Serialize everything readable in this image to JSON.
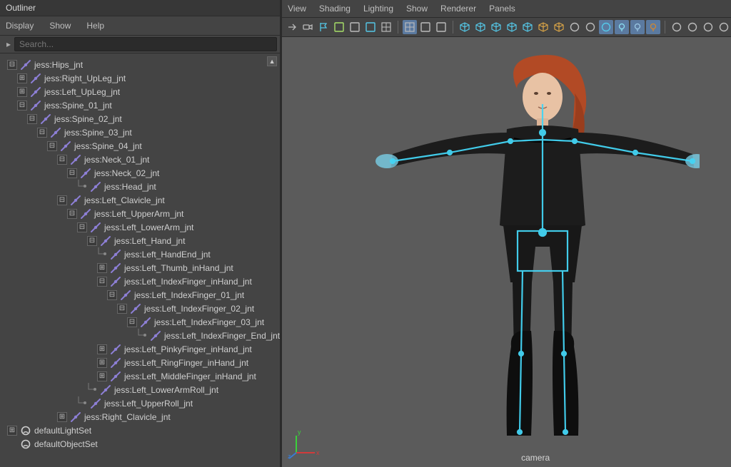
{
  "outliner": {
    "title": "Outliner",
    "menu": [
      "Display",
      "Show",
      "Help"
    ],
    "search_placeholder": "Search...",
    "tree": [
      {
        "d": 0,
        "exp": "minus",
        "ic": "joint",
        "label": "jess:Hips_jnt"
      },
      {
        "d": 1,
        "exp": "plus",
        "ic": "joint",
        "label": "jess:Right_UpLeg_jnt"
      },
      {
        "d": 1,
        "exp": "plus",
        "ic": "joint",
        "label": "jess:Left_UpLeg_jnt"
      },
      {
        "d": 1,
        "exp": "minus",
        "ic": "joint",
        "label": "jess:Spine_01_jnt"
      },
      {
        "d": 2,
        "exp": "minus",
        "ic": "joint",
        "label": "jess:Spine_02_jnt"
      },
      {
        "d": 3,
        "exp": "minus",
        "ic": "joint",
        "label": "jess:Spine_03_jnt"
      },
      {
        "d": 4,
        "exp": "minus",
        "ic": "joint",
        "label": "jess:Spine_04_jnt"
      },
      {
        "d": 5,
        "exp": "minus",
        "ic": "joint",
        "label": "jess:Neck_01_jnt"
      },
      {
        "d": 6,
        "exp": "minus",
        "ic": "joint",
        "label": "jess:Neck_02_jnt"
      },
      {
        "d": 7,
        "exp": "leaf",
        "ic": "joint",
        "label": "jess:Head_jnt"
      },
      {
        "d": 5,
        "exp": "minus",
        "ic": "joint",
        "label": "jess:Left_Clavicle_jnt"
      },
      {
        "d": 6,
        "exp": "minus",
        "ic": "joint",
        "label": "jess:Left_UpperArm_jnt"
      },
      {
        "d": 7,
        "exp": "minus",
        "ic": "joint",
        "label": "jess:Left_LowerArm_jnt"
      },
      {
        "d": 8,
        "exp": "minus",
        "ic": "joint",
        "label": "jess:Left_Hand_jnt"
      },
      {
        "d": 9,
        "exp": "leaf",
        "ic": "joint",
        "label": "jess:Left_HandEnd_jnt"
      },
      {
        "d": 9,
        "exp": "plus",
        "ic": "joint",
        "label": "jess:Left_Thumb_inHand_jnt"
      },
      {
        "d": 9,
        "exp": "minus",
        "ic": "joint",
        "label": "jess:Left_IndexFinger_inHand_jnt"
      },
      {
        "d": 10,
        "exp": "minus",
        "ic": "joint",
        "label": "jess:Left_IndexFinger_01_jnt"
      },
      {
        "d": 11,
        "exp": "minus",
        "ic": "joint",
        "label": "jess:Left_IndexFinger_02_jnt"
      },
      {
        "d": 12,
        "exp": "minus",
        "ic": "joint",
        "label": "jess:Left_IndexFinger_03_jnt"
      },
      {
        "d": 13,
        "exp": "leaf",
        "ic": "joint",
        "label": "jess:Left_IndexFinger_End_jnt"
      },
      {
        "d": 9,
        "exp": "plus",
        "ic": "joint",
        "label": "jess:Left_PinkyFinger_inHand_jnt"
      },
      {
        "d": 9,
        "exp": "plus",
        "ic": "joint",
        "label": "jess:Left_RingFinger_inHand_jnt"
      },
      {
        "d": 9,
        "exp": "plus",
        "ic": "joint",
        "label": "jess:Left_MiddleFinger_inHand_jnt"
      },
      {
        "d": 8,
        "exp": "leaf",
        "ic": "joint",
        "label": "jess:Left_LowerArmRoll_jnt"
      },
      {
        "d": 7,
        "exp": "leaf",
        "ic": "joint",
        "label": "jess:Left_UpperRoll_jnt"
      },
      {
        "d": 5,
        "exp": "plus",
        "ic": "joint",
        "label": "jess:Right_Clavicle_jnt"
      },
      {
        "d": 0,
        "exp": "plus",
        "ic": "set",
        "label": "defaultLightSet"
      },
      {
        "d": 0,
        "exp": "none",
        "ic": "set",
        "label": "defaultObjectSet"
      }
    ]
  },
  "viewport": {
    "menu": [
      "View",
      "Shading",
      "Lighting",
      "Show",
      "Renderer",
      "Panels"
    ],
    "camera_label": "camera",
    "axis": {
      "x": "x",
      "y": "y",
      "z": "z"
    },
    "toolbar": [
      {
        "name": "select-camera-icon",
        "c": "#bbb"
      },
      {
        "name": "camera-icon",
        "c": "#bbb"
      },
      {
        "name": "bookmark-icon",
        "c": "#55c8e8"
      },
      {
        "name": "image-plane-icon",
        "c": "#a8e069"
      },
      {
        "name": "film-gate-icon",
        "c": "#bbb"
      },
      {
        "name": "gate-mask-icon",
        "c": "#55c8e8"
      },
      {
        "name": "field-chart-icon",
        "c": "#bbb"
      },
      {
        "name": "sep"
      },
      {
        "name": "grid-icon",
        "c": "#bbb",
        "active": true
      },
      {
        "name": "resolution-gate-icon",
        "c": "#bbb"
      },
      {
        "name": "safe-action-icon",
        "c": "#bbb"
      },
      {
        "name": "sep"
      },
      {
        "name": "wireframe-icon",
        "c": "#55c8e8"
      },
      {
        "name": "smooth-shade-icon",
        "c": "#55c8e8"
      },
      {
        "name": "textured-icon",
        "c": "#55c8e8"
      },
      {
        "name": "use-lights-icon",
        "c": "#55c8e8"
      },
      {
        "name": "shadows-icon",
        "c": "#55c8e8"
      },
      {
        "name": "box1-icon",
        "c": "#d9a447"
      },
      {
        "name": "box2-icon",
        "c": "#d9a447"
      },
      {
        "name": "isolate-icon",
        "c": "#bbb"
      },
      {
        "name": "xray-icon",
        "c": "#bbb"
      },
      {
        "name": "xray-joints-icon",
        "c": "#55c8e8",
        "active": true
      },
      {
        "name": "light1-icon",
        "c": "#8adff2",
        "active": true
      },
      {
        "name": "light2-icon",
        "c": "#9bc8e4",
        "active": true
      },
      {
        "name": "light3-icon",
        "c": "#d2872f",
        "active": true
      },
      {
        "name": "sep"
      },
      {
        "name": "ssao-icon",
        "c": "#bbb"
      },
      {
        "name": "motion-blur-icon",
        "c": "#bbb"
      },
      {
        "name": "aa-icon",
        "c": "#bbb"
      },
      {
        "name": "dof-icon",
        "c": "#bbb"
      },
      {
        "name": "sep"
      },
      {
        "name": "exposure-icon",
        "c": "#55c8e8"
      },
      {
        "name": "gamma-icon",
        "c": "#bbb"
      },
      {
        "name": "view-transform-icon",
        "c": "#bbb"
      }
    ]
  }
}
